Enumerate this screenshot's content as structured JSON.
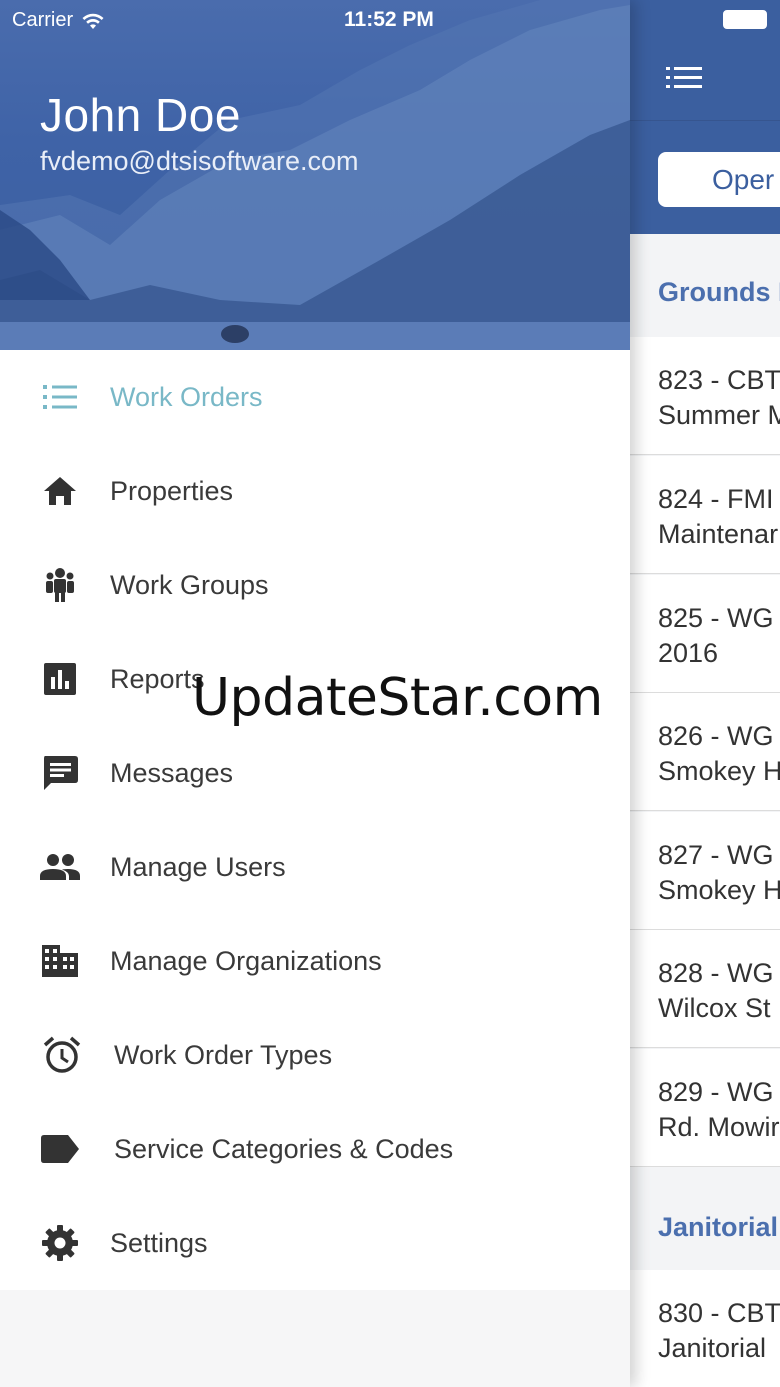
{
  "status_bar": {
    "carrier": "Carrier",
    "time": "11:52 PM"
  },
  "drawer": {
    "user_name": "John Doe",
    "user_email": "fvdemo@dtsisoftware.com",
    "items": [
      {
        "label": "Work Orders",
        "icon": "list-icon",
        "active": true
      },
      {
        "label": "Properties",
        "icon": "home-icon"
      },
      {
        "label": "Work Groups",
        "icon": "group-icon"
      },
      {
        "label": "Reports",
        "icon": "bar-chart-icon"
      },
      {
        "label": "Messages",
        "icon": "message-icon"
      },
      {
        "label": "Manage Users",
        "icon": "users-icon"
      },
      {
        "label": "Manage Organizations",
        "icon": "building-icon"
      },
      {
        "label": "Work Order Types",
        "icon": "alarm-clock-icon"
      },
      {
        "label": "Service Categories & Codes",
        "icon": "tag-icon"
      },
      {
        "label": "Settings",
        "icon": "gear-icon"
      }
    ],
    "active_color": "#79b8c7"
  },
  "main": {
    "segment_label": "Oper",
    "sections": [
      {
        "title": "Grounds I",
        "rows": [
          {
            "line1": "823 - CBT",
            "line2": "Summer M"
          },
          {
            "line1": "824 - FMI",
            "line2": "Maintenar"
          },
          {
            "line1": "825 - WG",
            "line2": "2016"
          },
          {
            "line1": "826 - WG",
            "line2": "Smokey H"
          },
          {
            "line1": "827 - WG",
            "line2": "Smokey H"
          },
          {
            "line1": "828 - WG",
            "line2": "Wilcox St"
          },
          {
            "line1": "829 - WG",
            "line2": "Rd. Mowir"
          }
        ]
      },
      {
        "title": "Janitorial",
        "rows": [
          {
            "line1": "830 - CBT",
            "line2": "Janitorial"
          }
        ]
      }
    ],
    "brand_color": "#3b5f9f"
  },
  "watermark": "UpdateStar.com"
}
